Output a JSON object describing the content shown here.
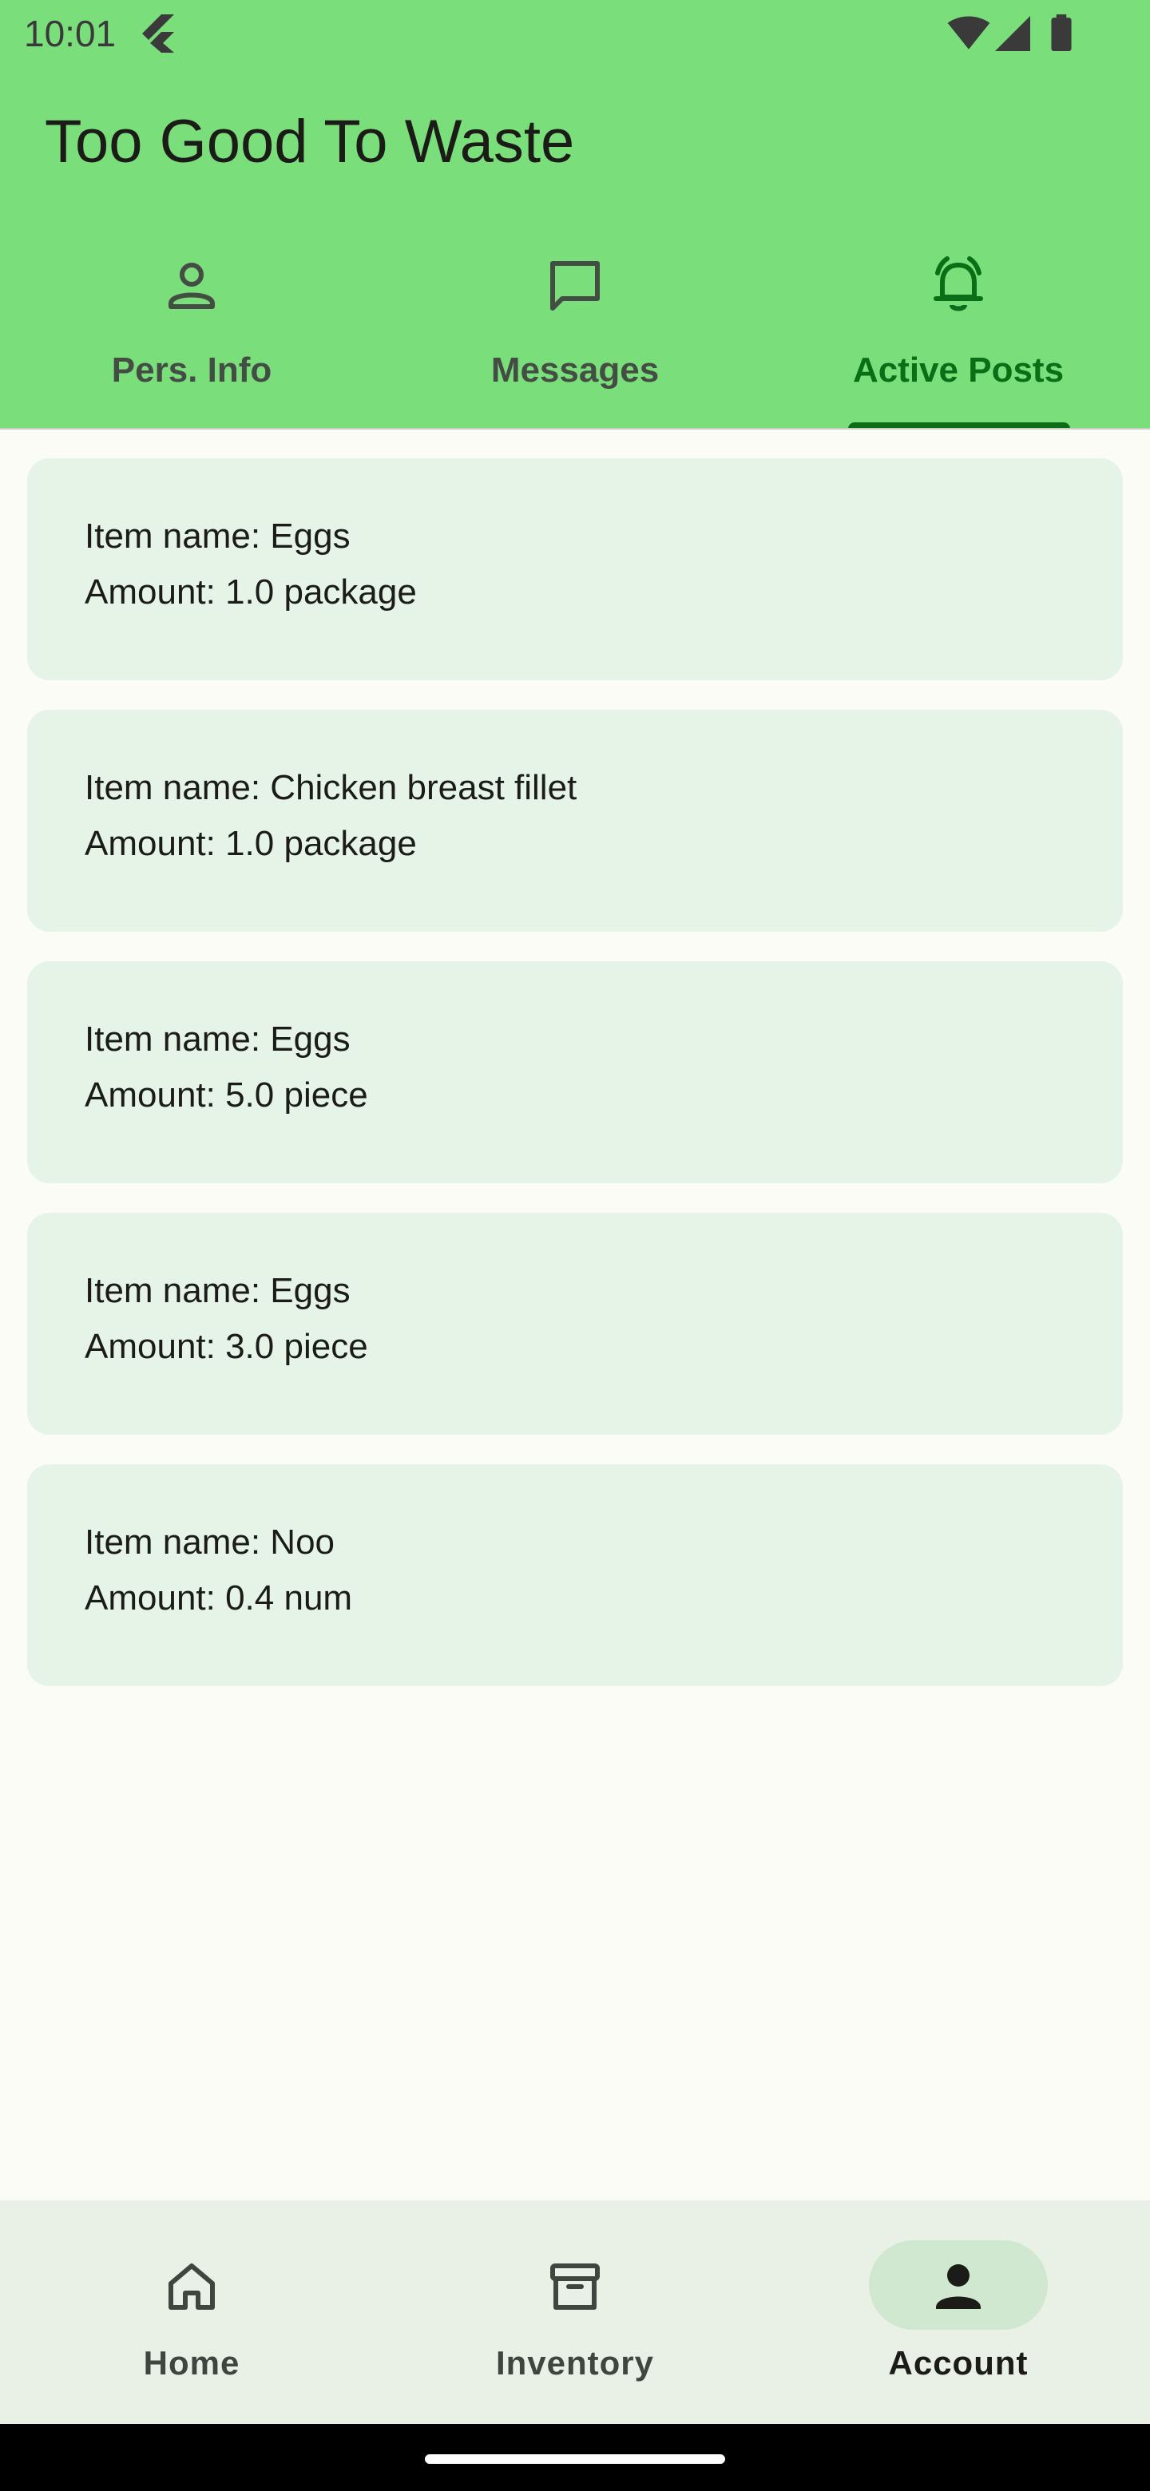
{
  "status_bar": {
    "time": "10:01"
  },
  "app": {
    "title": "Too Good To Waste"
  },
  "tabs": [
    {
      "label": "Pers. Info",
      "icon": "person-icon",
      "active": false
    },
    {
      "label": "Messages",
      "icon": "chat-icon",
      "active": false
    },
    {
      "label": "Active Posts",
      "icon": "notification-bell-icon",
      "active": true
    }
  ],
  "posts": [
    {
      "name_line": "Item name: Eggs",
      "amount_line": "Amount: 1.0 package"
    },
    {
      "name_line": "Item name: Chicken breast fillet",
      "amount_line": "Amount: 1.0 package"
    },
    {
      "name_line": "Item name: Eggs",
      "amount_line": "Amount: 5.0 piece"
    },
    {
      "name_line": "Item name: Eggs",
      "amount_line": "Amount: 3.0 piece"
    },
    {
      "name_line": "Item name: Noo",
      "amount_line": "Amount: 0.4 num"
    }
  ],
  "bottom_nav": [
    {
      "label": "Home",
      "icon": "home-icon",
      "active": false
    },
    {
      "label": "Inventory",
      "icon": "archive-box-icon",
      "active": false
    },
    {
      "label": "Account",
      "icon": "person-filled-icon",
      "active": true
    }
  ],
  "colors": {
    "app_bar": "#7ade7a",
    "accent": "#0a6e16",
    "card": "#e6f4e8",
    "background": "#fbfcf6",
    "nav_background": "#e9f0e6",
    "nav_pill": "#cfe8cf"
  }
}
